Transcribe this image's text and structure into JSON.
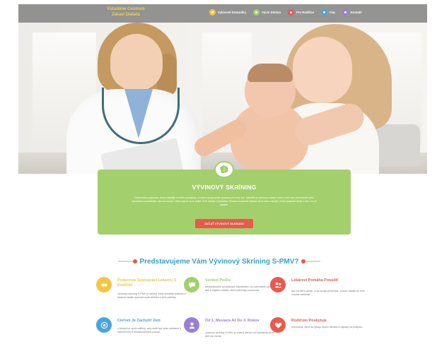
{
  "colors": {
    "accent_green": "#a3cf6c",
    "accent_red": "#e9594c",
    "heading_blue": "#3aa0c9",
    "brand_yellow": "#f5d14b"
  },
  "nav": {
    "brand_line1": "Vstudáne Centrum",
    "brand_line2": "Zdraví Dietata",
    "items": [
      {
        "label": "Vykivové Dotazníky",
        "color": "#f4c542",
        "icon": "circle-icon"
      },
      {
        "label": "Vývin Dietata",
        "color": "#a3cf6c",
        "icon": "circle-icon"
      },
      {
        "label": "Pre Rodičov",
        "color": "#e9594c",
        "icon": "circle-icon"
      },
      {
        "label": "Faq",
        "color": "#4aa4d9",
        "icon": "circle-icon"
      },
      {
        "label": "Kontakt",
        "color": "#9a7fd1",
        "icon": "circle-icon"
      }
    ]
  },
  "screening": {
    "badge_icon": "brain-icon",
    "title": "VÝVINOVÝ SKRÍNING",
    "text": "Odborníčka pripravila, ktorý zapájajú a veľmi pomáhajú, či dieťa vyvíja podľa správne pre svoj vek. Dôležité je vývinovú oblasť veľmi a tiež viac porozumieť jeho správaniu a potrebám, ako sa rozvíja. Viete aspoň za to vidieť, či je všetko v poriadku. Skúste si vytvoriť oblasti, ktoré skôr rozvíjať, a tiež podporiť dieťa v tom, čo už dokáže.",
    "button_label": "ZAČAŤ VÝVINOVÝ SKRÍNING"
  },
  "section": {
    "title": "Predstavujeme Vám Vývinový Skríning S-PMV?"
  },
  "features": [
    {
      "icon": "handshake-icon",
      "color": "#f4c542",
      "title": "Podporuje Spolupráci Lekárov S Rodičmi",
      "text": "Vývinový skríning S-PMV je nástroj, ktorý pomáha rodičom a lekárom lepšie spoznať vývin dieťaťa a jeho potreby."
    },
    {
      "icon": "chat-icon",
      "color": "#a3cf6c",
      "title": "Vznikol Podľa",
      "text": "medzinárodne uznávaných štandardov, na overovanie vývinu detí a nájdení oblastí, ktoré potrebujú pozornosť."
    },
    {
      "icon": "people-icon",
      "color": "#e9594c",
      "title": "Lekárovi Pomáha Posúdiť",
      "text": "ako sa dieťa vyvíja, či sa vyvíja primerane, a ktoré oblasti by bolo vhodné sledovať."
    },
    {
      "icon": "target-icon",
      "color": "#4aa4d9",
      "title": "Cieľom Je Zachytiť Deti",
      "text": "u ktorých je vývin odlišný, aby mohli byť včas odoslané k odborníkom a dostali potrebnú pomoc."
    },
    {
      "icon": "baby-icon",
      "color": "#9a7fd1",
      "title": "Od 1. Mesiaca Až Do 3. Rokov",
      "text": "vývinový skríning S-PMV je určený deťom od narodenia až po tretí rok života."
    },
    {
      "icon": "heart-icon",
      "color": "#e9594c",
      "title": "Rodičom Poskytuje",
      "text": "informácie, ktoré sa týkajú vývinu dieťaťa a nápady na podporu."
    }
  ]
}
